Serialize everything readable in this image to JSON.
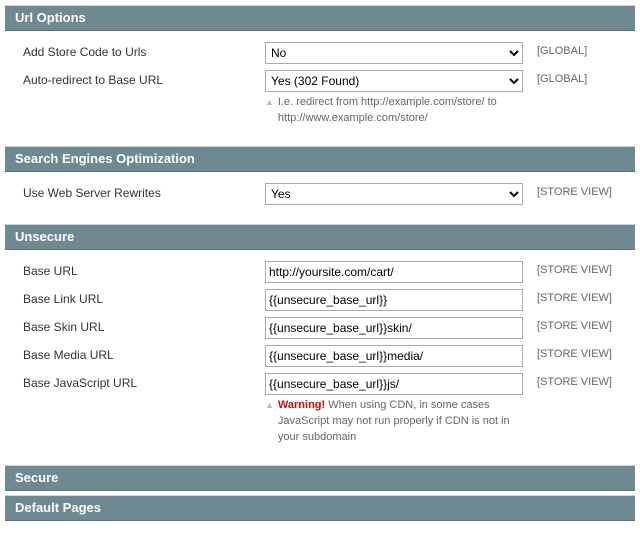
{
  "sections": {
    "url_options": {
      "title": "Url Options",
      "fields": {
        "add_store_code": {
          "label": "Add Store Code to Urls",
          "value": "No",
          "scope": "[GLOBAL]"
        },
        "auto_redirect": {
          "label": "Auto-redirect to Base URL",
          "value": "Yes (302 Found)",
          "scope": "[GLOBAL]",
          "hint": "I.e. redirect from http://example.com/store/ to http://www.example.com/store/"
        }
      }
    },
    "seo": {
      "title": "Search Engines Optimization",
      "fields": {
        "rewrites": {
          "label": "Use Web Server Rewrites",
          "value": "Yes",
          "scope": "[STORE VIEW]"
        }
      }
    },
    "unsecure": {
      "title": "Unsecure",
      "fields": {
        "base_url": {
          "label": "Base URL",
          "value": "http://yoursite.com/cart/",
          "scope": "[STORE VIEW]"
        },
        "base_link_url": {
          "label": "Base Link URL",
          "value": "{{unsecure_base_url}}",
          "scope": "[STORE VIEW]"
        },
        "base_skin_url": {
          "label": "Base Skin URL",
          "value": "{{unsecure_base_url}}skin/",
          "scope": "[STORE VIEW]"
        },
        "base_media_url": {
          "label": "Base Media URL",
          "value": "{{unsecure_base_url}}media/",
          "scope": "[STORE VIEW]"
        },
        "base_js_url": {
          "label": "Base JavaScript URL",
          "value": "{{unsecure_base_url}}js/",
          "scope": "[STORE VIEW]",
          "warning_label": "Warning!",
          "hint": " When using CDN, in some cases JavaScript may not run properly if CDN is not in your subdomain"
        }
      }
    },
    "secure": {
      "title": "Secure"
    },
    "default_pages": {
      "title": "Default Pages"
    }
  }
}
